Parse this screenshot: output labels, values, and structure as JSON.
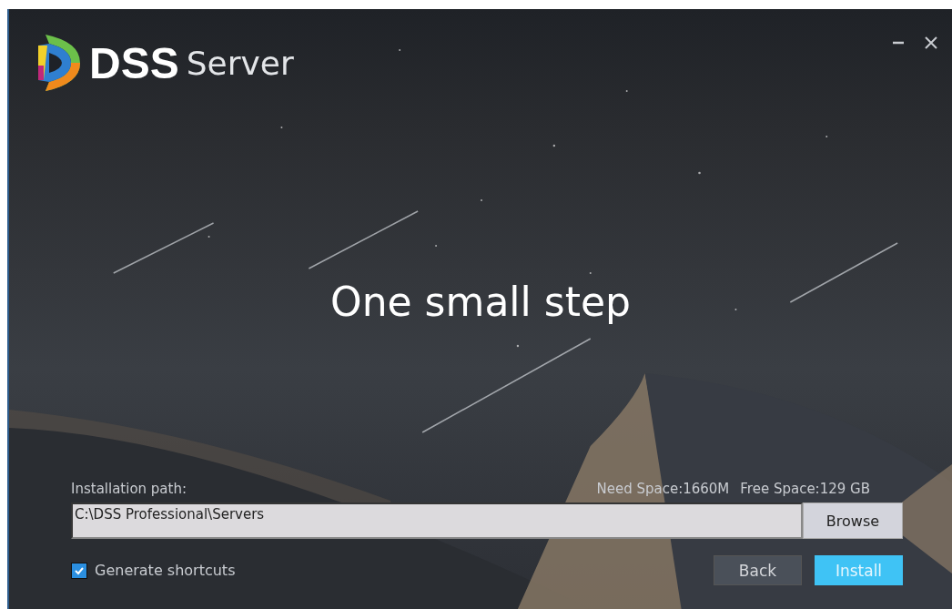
{
  "logo": {
    "brand": "DSS",
    "product": "Server"
  },
  "window_controls": [
    {
      "kind": "minimize"
    },
    {
      "kind": "close"
    }
  ],
  "headline": "One small step",
  "install_path": {
    "label": "Installation path:",
    "need_space": "Need Space:1660M",
    "free_space": "Free Space:129 GB",
    "value": "C:\\DSS Professional\\Servers",
    "browse_button": "Browse"
  },
  "shortcut_checkbox": {
    "label": "Generate shortcuts",
    "checked": true
  },
  "buttons": [
    {
      "label": "Back",
      "kind": "secondary"
    },
    {
      "label": "Install",
      "kind": "primary"
    }
  ]
}
